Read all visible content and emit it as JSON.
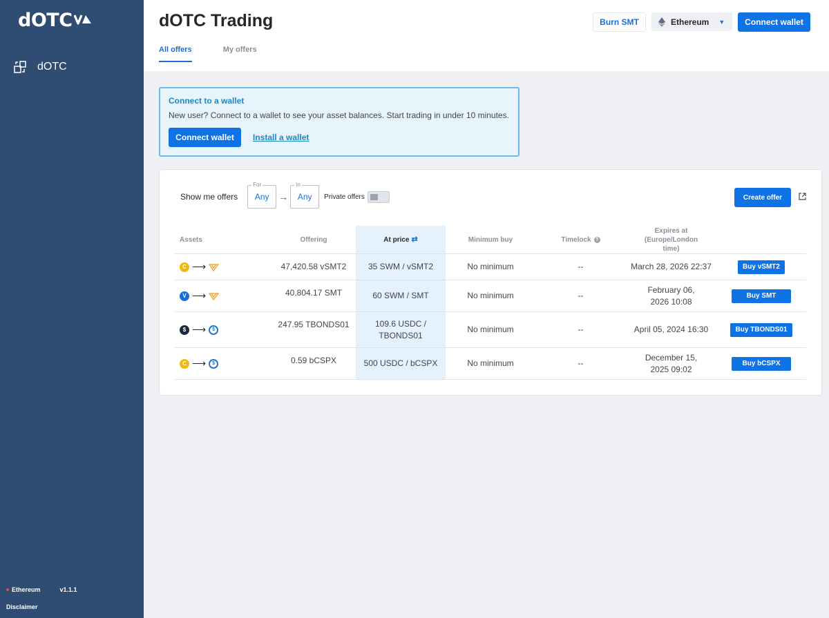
{
  "sidebar": {
    "logo": "dOTC",
    "nav_item": "dOTC",
    "network": "Ethereum",
    "version": "v1.1.1",
    "disclaimer": "Disclaimer"
  },
  "header": {
    "title": "dOTC Trading",
    "tabs": [
      {
        "label": "All offers",
        "active": true
      },
      {
        "label": "My offers",
        "active": false
      }
    ],
    "burn_label": "Burn SMT",
    "network_label": "Ethereum",
    "connect_label": "Connect wallet"
  },
  "banner": {
    "title": "Connect to a wallet",
    "text": "New user? Connect to a wallet to see your asset balances. Start trading in under 10 minutes.",
    "connect_label": "Connect wallet",
    "install_label": "Install a wallet"
  },
  "filters": {
    "show_label": "Show me offers",
    "for_legend": "For",
    "for_value": "Any",
    "in_legend": "In",
    "in_value": "Any",
    "private_label": "Private offers",
    "private_enabled": false,
    "create_label": "Create offer"
  },
  "table": {
    "headers": {
      "assets": "Assets",
      "offering": "Offering",
      "price": "At price",
      "minimum": "Minimum buy",
      "timelock": "Timelock",
      "expires": "Expires at (Europe/London time)"
    },
    "rows": [
      {
        "from_icon": "coin-c-icon",
        "to_icon": "smt-icon",
        "offering": "47,420.58 vSMT2",
        "price": "35 SWM / vSMT2",
        "minimum": "No minimum",
        "timelock": "--",
        "expires": "March 28, 2026 22:37",
        "action": "Buy vSMT2"
      },
      {
        "from_icon": "swm-icon",
        "to_icon": "smt-icon",
        "offering": "40,804.17 SMT",
        "price": "60 SWM / SMT",
        "minimum": "No minimum",
        "timelock": "--",
        "expires": "February 06, 2026 10:08",
        "action": "Buy SMT"
      },
      {
        "from_icon": "dollar-icon",
        "to_icon": "usdc-icon",
        "offering": "247.95 TBONDS01",
        "price": "109.6 USDC / TBONDS01",
        "minimum": "No minimum",
        "timelock": "--",
        "expires": "April 05, 2024 16:30",
        "action": "Buy TBONDS01"
      },
      {
        "from_icon": "coin-c-icon",
        "to_icon": "usdc-icon",
        "offering": "0.59 bCSPX",
        "price": "500 USDC / bCSPX",
        "minimum": "No minimum",
        "timelock": "--",
        "expires": "December 15, 2025 09:02",
        "action": "Buy bCSPX"
      }
    ]
  },
  "colors": {
    "sidebar_bg": "#2f4d73",
    "accent": "#0f73e6",
    "price_column_bg": "#e5f1fb",
    "banner_border": "#6cb8ea"
  }
}
